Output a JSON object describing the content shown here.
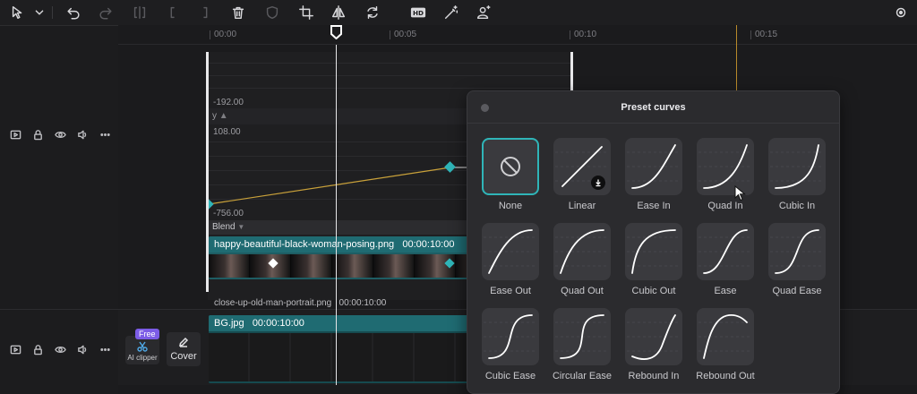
{
  "toolbar": {
    "icons": [
      "cursor-select-icon",
      "chevron-down-icon",
      "undo-icon",
      "redo-icon",
      "split-icon",
      "trim-left-icon",
      "trim-right-icon",
      "delete-icon",
      "shield-icon",
      "crop-icon",
      "mirror-icon",
      "rotate-icon",
      "hd-icon",
      "magic-wand-icon",
      "person-sparkle-icon"
    ],
    "hd_label": "HD"
  },
  "ruler": {
    "labels": [
      "00:00",
      "00:05",
      "00:10",
      "00:15"
    ]
  },
  "keyframe_editor": {
    "top_value": "-192.00",
    "prop_label": "y",
    "mid_value": "108.00",
    "bottom_value": "-756.00"
  },
  "tracks": {
    "blend_label": "Blend",
    "main_clip": {
      "name": "happy-beautiful-black-woman-posing.png",
      "duration": "00:00:10:00"
    },
    "sub_clip": {
      "name": "close-up-old-man-portrait.png",
      "duration": "00:00:10:00"
    },
    "bg_clip": {
      "name": "BG.jpg",
      "duration": "00:00:10:00"
    }
  },
  "ai_clipper": {
    "badge": "Free",
    "label": "AI clipper"
  },
  "cover": {
    "label": "Cover"
  },
  "preset_curves": {
    "title": "Preset curves",
    "items": [
      {
        "label": "None",
        "curve": "none",
        "selected": true
      },
      {
        "label": "Linear",
        "curve": "linear",
        "download": true
      },
      {
        "label": "Ease In",
        "curve": "ease-in"
      },
      {
        "label": "Quad In",
        "curve": "quad-in"
      },
      {
        "label": "Cubic In",
        "curve": "cubic-in"
      },
      {
        "label": "Ease Out",
        "curve": "ease-out"
      },
      {
        "label": "Quad Out",
        "curve": "quad-out"
      },
      {
        "label": "Cubic Out",
        "curve": "cubic-out"
      },
      {
        "label": "Ease",
        "curve": "ease"
      },
      {
        "label": "Quad Ease",
        "curve": "quad-ease"
      },
      {
        "label": "Cubic Ease",
        "curve": "cubic-ease"
      },
      {
        "label": "Circular Ease",
        "curve": "circular-ease"
      },
      {
        "label": "Rebound In",
        "curve": "rebound-in"
      },
      {
        "label": "Rebound Out",
        "curve": "rebound-out"
      }
    ]
  },
  "colors": {
    "accent": "#2fb5b8",
    "clip": "#1f6b72",
    "keyframe_line": "#c9a13a",
    "free_badge": "#7c5ce6"
  }
}
